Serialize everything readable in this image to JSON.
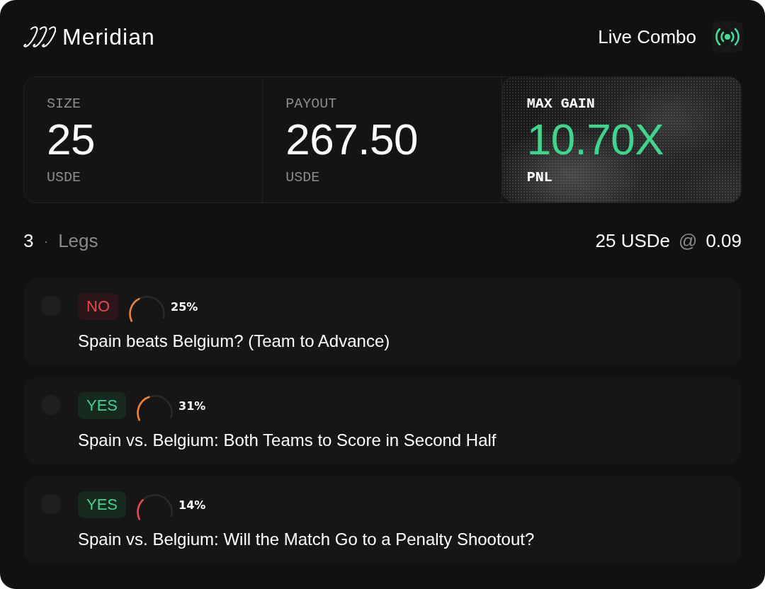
{
  "brand": {
    "name": "Meridian"
  },
  "header": {
    "title": "Live Combo"
  },
  "stats": [
    {
      "kind": "plain",
      "label": "SIZE",
      "value": "25",
      "unit": "USDE"
    },
    {
      "kind": "plain",
      "label": "PAYOUT",
      "value": "267.50",
      "unit": "USDE"
    },
    {
      "kind": "highlight",
      "label": "MAX GAIN",
      "value": "10.70X",
      "unit": "PNL"
    }
  ],
  "legs_summary": {
    "count": "3",
    "separator": "·",
    "label": "Legs",
    "stake": "25 USDe",
    "at": "@",
    "price": "0.09"
  },
  "legs": [
    {
      "kind": "no",
      "side": "NO",
      "percent": "25%",
      "level": 0.25,
      "color": "#f2832c",
      "question": "Spain beats Belgium? (Team to Advance)"
    },
    {
      "kind": "yes",
      "side": "YES",
      "percent": "31%",
      "level": 0.31,
      "color": "#f2832c",
      "question": "Spain vs. Belgium: Both Teams to Score in Second Half"
    },
    {
      "kind": "yes",
      "side": "YES",
      "percent": "14%",
      "level": 0.14,
      "color": "#e5484d",
      "question": "Spain vs. Belgium: Will the Match Go to a Penalty Shootout?"
    }
  ]
}
